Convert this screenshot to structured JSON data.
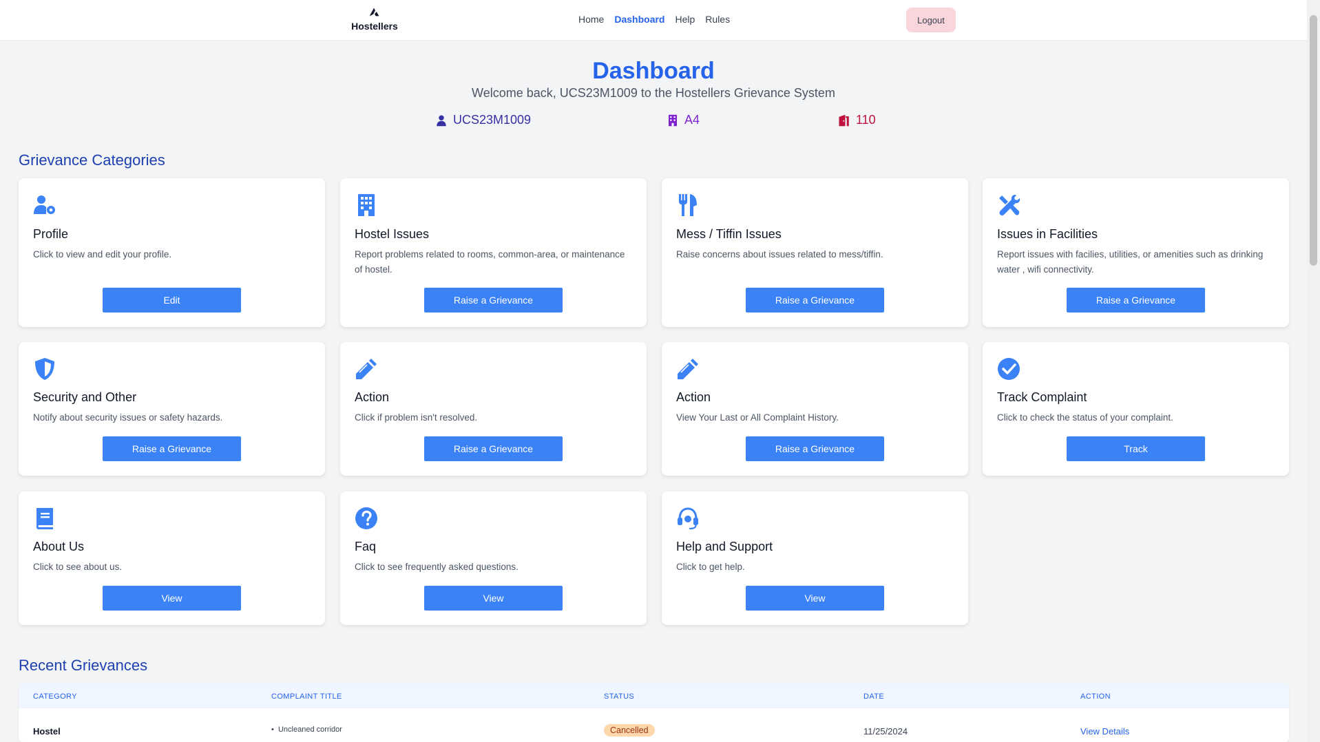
{
  "nav": {
    "brand": "Hostellers",
    "links": [
      "Home",
      "Dashboard",
      "Help",
      "Rules"
    ],
    "active": "Dashboard",
    "logout_label": "Logout"
  },
  "hero": {
    "title": "Dashboard",
    "subtitle": "Welcome back, UCS23M1009 to the Hostellers Grievance System"
  },
  "user_info": {
    "roll_no": "UCS23M1009",
    "block": "A4",
    "room": "110"
  },
  "categories_title": "Grievance Categories",
  "cards": [
    {
      "icon": "user-gear-icon",
      "title": "Profile",
      "desc": "Click to view and edit your profile.",
      "button": "Edit"
    },
    {
      "icon": "building-icon",
      "title": "Hostel Issues",
      "desc": "Report problems related to rooms, common-area, or maintenance of hostel.",
      "button": "Raise a Grievance"
    },
    {
      "icon": "utensils-icon",
      "title": "Mess / Tiffin Issues",
      "desc": "Raise concerns about issues related to mess/tiffin.",
      "button": "Raise a Grievance"
    },
    {
      "icon": "tools-icon",
      "title": "Issues in Facilities",
      "desc": "Report issues with facilies, utilities, or amenities such as drinking water , wifi connectivity.",
      "button": "Raise a Grievance"
    },
    {
      "icon": "shield-icon",
      "title": "Security and Other",
      "desc": "Notify about security issues or safety hazards.",
      "button": "Raise a Grievance"
    },
    {
      "icon": "pencil-icon",
      "title": "Action",
      "desc": "Click if problem isn't resolved.",
      "button": "Raise a Grievance"
    },
    {
      "icon": "pencil-icon",
      "title": "Action",
      "desc": "View Your Last or All Complaint History.",
      "button": "Raise a Grievance"
    },
    {
      "icon": "check-circle-icon",
      "title": "Track Complaint",
      "desc": "Click to check the status of your complaint.",
      "button": "Track"
    },
    {
      "icon": "book-icon",
      "title": "About Us",
      "desc": "Click to see about us.",
      "button": "View"
    },
    {
      "icon": "question-circle-icon",
      "title": "Faq",
      "desc": "Click to see frequently asked questions.",
      "button": "View"
    },
    {
      "icon": "headset-icon",
      "title": "Help and Support",
      "desc": "Click to get help.",
      "button": "View"
    }
  ],
  "recent_title": "Recent Grievances",
  "table": {
    "headers": [
      "CATEGORY",
      "COMPLAINT TITLE",
      "STATUS",
      "DATE",
      "ACTION"
    ],
    "rows": [
      {
        "category": "Hostel",
        "title": "Uncleaned corridor",
        "status": "Cancelled",
        "date": "11/25/2024",
        "action": "View Details"
      }
    ]
  },
  "colors": {
    "accent": "#2563eb",
    "button": "#3b82f6",
    "logout_bg": "#fbd5dc",
    "roll_color": "#3730a3",
    "block_color": "#7e22ce",
    "room_color": "#be123c",
    "status_cancelled_bg": "#fed7aa"
  }
}
